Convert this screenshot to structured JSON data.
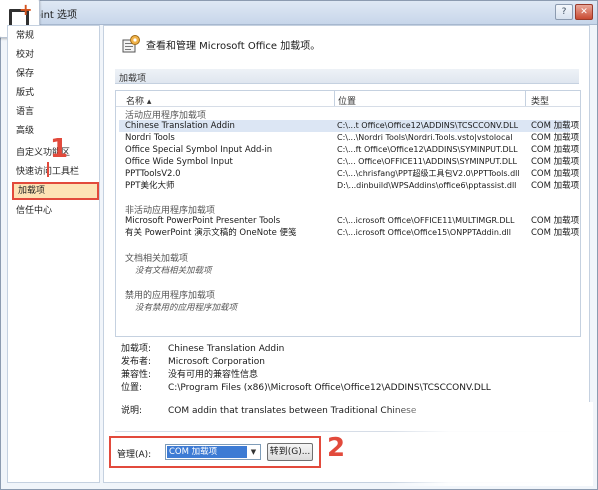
{
  "window": {
    "title": "Point 选项",
    "help_btn": "?",
    "close_btn": "✕"
  },
  "sidebar": {
    "items": [
      {
        "label": "常规"
      },
      {
        "label": "校对"
      },
      {
        "label": "保存"
      },
      {
        "label": "版式"
      },
      {
        "label": "语言"
      },
      {
        "label": "高级"
      },
      {
        "label": "自定义功能区"
      },
      {
        "label": "快速访问工具栏"
      },
      {
        "label": "加载项"
      },
      {
        "label": "信任中心"
      }
    ],
    "selected": "加载项"
  },
  "header": {
    "text": "查看和管理 Microsoft Office 加载项。"
  },
  "section": {
    "title": "加载项"
  },
  "addins": {
    "columns": {
      "name": "名称 ▴",
      "location": "位置",
      "type": "类型"
    },
    "active_group": "活动应用程序加载项",
    "active": [
      {
        "name": "Chinese Translation Addin",
        "location": "C:\\...t Office\\Office12\\ADDINS\\TCSCCONV.DLL",
        "type": "COM 加载项"
      },
      {
        "name": "Nordri Tools",
        "location": "C:\\...\\Nordri Tools\\Nordri.Tools.vsto|vstolocal",
        "type": "COM 加载项"
      },
      {
        "name": "Office Special Symbol Input Add-in",
        "location": "C:\\...ft Office\\Office12\\ADDINS\\SYMINPUT.DLL",
        "type": "COM 加载项"
      },
      {
        "name": "Office Wide Symbol Input",
        "location": "C:\\... Office\\OFFICE11\\ADDINS\\SYMINPUT.DLL",
        "type": "COM 加载项"
      },
      {
        "name": "PPTToolsV2.0",
        "location": "C:\\...\\chrisfang\\PPT超级工具包V2.0\\PPTTools.dll",
        "type": "COM 加载项"
      },
      {
        "name": "PPT美化大师",
        "location": "D:\\...dinbuild\\WPSAddins\\office6\\pptassist.dll",
        "type": "COM 加载项"
      }
    ],
    "inactive_group": "非活动应用程序加载项",
    "inactive": [
      {
        "name": "Microsoft PowerPoint Presenter Tools",
        "location": "C:\\...icrosoft Office\\OFFICE11\\MULTIMGR.DLL",
        "type": "COM 加载项"
      },
      {
        "name": "有关 PowerPoint 演示文稿的 OneNote 便笺",
        "location": "C:\\...icrosoft Office\\Office15\\ONPPTAddin.dll",
        "type": "COM 加载项"
      }
    ],
    "doc_group": "文档相关加载项",
    "doc_empty": "没有文档相关加载项",
    "disabled_group": "禁用的应用程序加载项",
    "disabled_empty": "没有禁用的应用程序加载项"
  },
  "details": {
    "addin_label": "加载项:",
    "addin_value": "Chinese Translation Addin",
    "publisher_label": "发布者:",
    "publisher_value": "Microsoft Corporation",
    "compat_label": "兼容性:",
    "compat_value": "没有可用的兼容性信息",
    "location_label": "位置:",
    "location_value": "C:\\Program Files (x86)\\Microsoft Office\\Office12\\ADDINS\\TCSCCONV.DLL",
    "desc_label": "说明:",
    "desc_value": "COM addin that translates between Traditional Chinese"
  },
  "manage": {
    "label": "管理(A):",
    "selected": "COM 加载项",
    "go_label": "转到(G)..."
  },
  "annotations": {
    "step1": "1",
    "step2": "2",
    "color": "#e24a3c"
  }
}
